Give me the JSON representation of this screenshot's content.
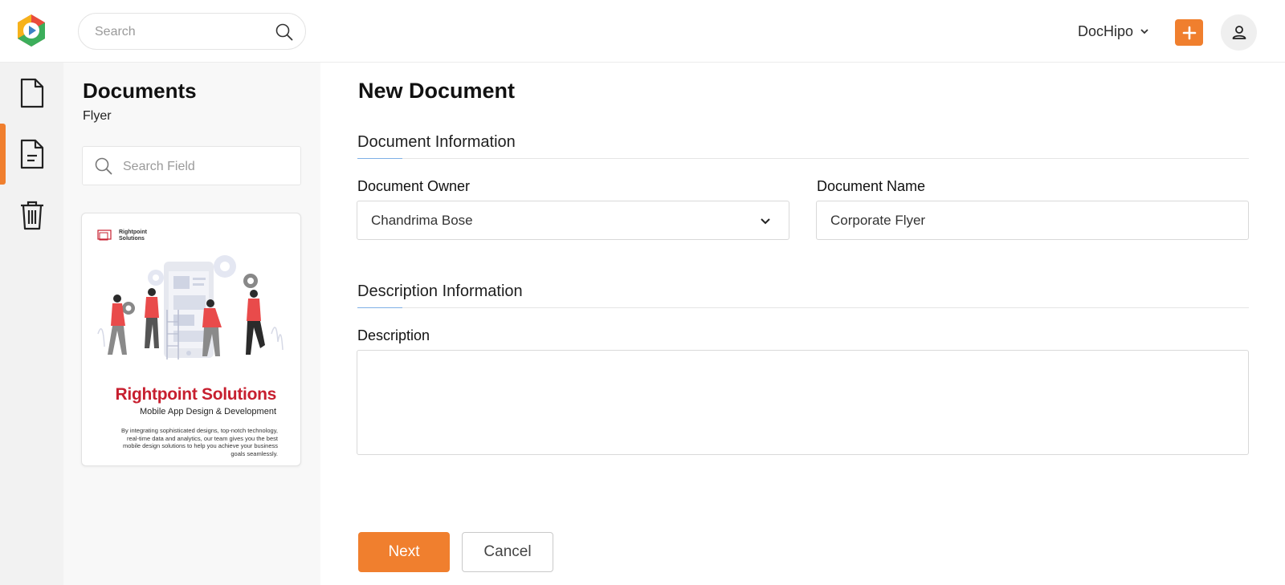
{
  "header": {
    "search_placeholder": "Search",
    "account_label": "DocHipo",
    "accent_color": "#f07f2e"
  },
  "rail": {
    "items": [
      {
        "icon": "document-icon",
        "active": false
      },
      {
        "icon": "text-document-icon",
        "active": true
      },
      {
        "icon": "trash-icon",
        "active": false
      }
    ]
  },
  "panel": {
    "title": "Documents",
    "subtitle": "Flyer",
    "search_placeholder": "Search Field",
    "thumbnail": {
      "brand_line1": "Rightpoint",
      "brand_line2": "Solutions",
      "title": "Rightpoint Solutions",
      "subtitle": "Mobile App Design & Development",
      "body": "By integrating sophisticated designs, top-notch technology, real-time data and analytics, our team gives you the best mobile design solutions to help you achieve your business goals seamlessly."
    }
  },
  "main": {
    "title": "New Document",
    "document_info": {
      "heading": "Document Information",
      "owner_label": "Document Owner",
      "owner_value": "Chandrima Bose",
      "name_label": "Document Name",
      "name_value": "Corporate Flyer"
    },
    "description_info": {
      "heading": "Description Information",
      "description_label": "Description",
      "description_value": ""
    },
    "buttons": {
      "next": "Next",
      "cancel": "Cancel"
    }
  }
}
